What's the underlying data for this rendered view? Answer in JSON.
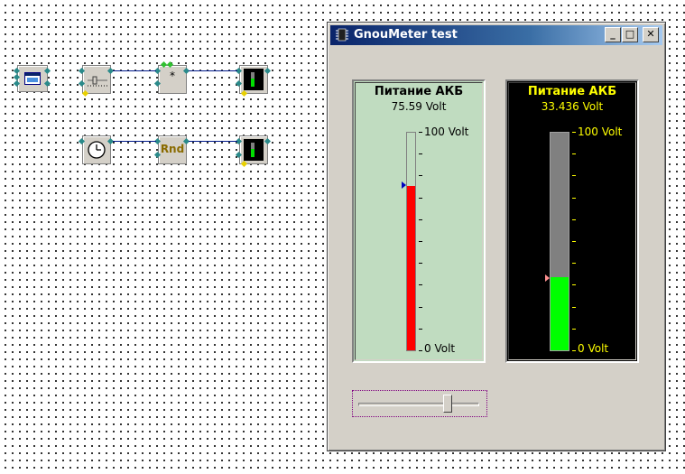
{
  "window": {
    "title": "GnouMeter test",
    "buttons": {
      "minimize": "_",
      "maximize": "□",
      "close": "✕"
    }
  },
  "diagram": {
    "mul_label": "*",
    "rnd_label": "Rnd"
  },
  "gauge_left": {
    "title": "Питание АКБ",
    "value": "75.59 Volt",
    "max_label": "100 Volt",
    "min_label": "0 Volt",
    "level": 0.7559,
    "fill_color": "#ff0000",
    "background": "#c0dcc0"
  },
  "gauge_right": {
    "title": "Питание АКБ",
    "value": "33.436 Volt",
    "max_label": "100 Volt",
    "min_label": "0 Volt",
    "level": 0.33436,
    "fill_color": "#00ff00",
    "background": "#000000",
    "text_color": "#ffff00"
  },
  "slider": {
    "value": 0.76
  }
}
